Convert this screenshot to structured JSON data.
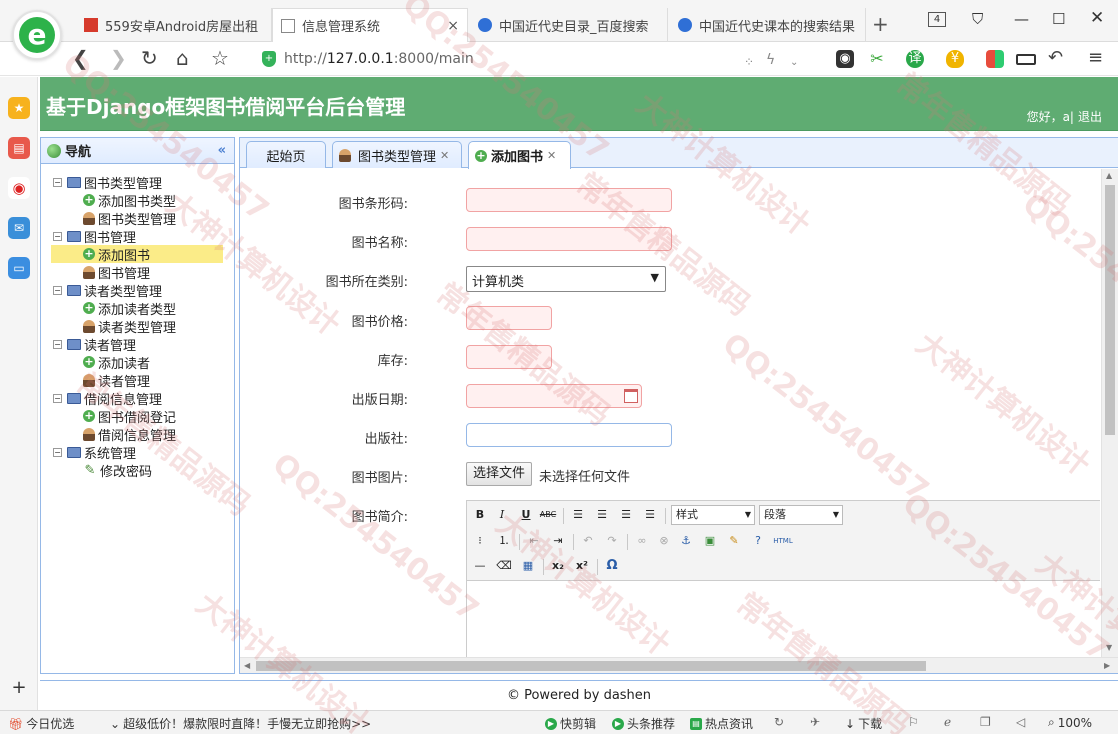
{
  "browser": {
    "tabs": [
      {
        "label": "559安卓Android房屋出租",
        "favicon_color": "#d63a2c"
      },
      {
        "label": "信息管理系统",
        "active": true
      },
      {
        "label": "中国近代史目录_百度搜索",
        "favicon_color": "#2f6fd6"
      },
      {
        "label": "中国近代史课本的搜索结果",
        "favicon_color": "#2f6fd6"
      }
    ],
    "tab_close": "×",
    "new_tab": "+",
    "tab_count": "4",
    "url_prefix": "http://",
    "url_host": "127.0.0.1",
    "url_rest": ":8000/main"
  },
  "app": {
    "title": "基于Django框架图书借阅平台后台管理",
    "greeting": "您好，a|",
    "logout": "退出",
    "accent_color": "#5fac72"
  },
  "nav": {
    "title": "导航",
    "collapse_icon": "«",
    "groups": [
      {
        "label": "图书类型管理",
        "children": [
          {
            "label": "添加图书类型",
            "icon": "add-icon"
          },
          {
            "label": "图书类型管理",
            "icon": "user-icon"
          }
        ]
      },
      {
        "label": "图书管理",
        "children": [
          {
            "label": "添加图书",
            "icon": "add-icon",
            "selected": true
          },
          {
            "label": "图书管理",
            "icon": "user-icon"
          }
        ]
      },
      {
        "label": "读者类型管理",
        "children": [
          {
            "label": "添加读者类型",
            "icon": "add-icon"
          },
          {
            "label": "读者类型管理",
            "icon": "user-icon"
          }
        ]
      },
      {
        "label": "读者管理",
        "children": [
          {
            "label": "添加读者",
            "icon": "add-icon"
          },
          {
            "label": "读者管理",
            "icon": "user-icon"
          }
        ]
      },
      {
        "label": "借阅信息管理",
        "children": [
          {
            "label": "图书借阅登记",
            "icon": "add-icon"
          },
          {
            "label": "借阅信息管理",
            "icon": "user-icon"
          }
        ]
      },
      {
        "label": "系统管理",
        "children": [
          {
            "label": "修改密码",
            "icon": "pencil-icon"
          }
        ]
      }
    ]
  },
  "main_tabs": [
    {
      "label": "起始页"
    },
    {
      "label": "图书类型管理",
      "closable": true
    },
    {
      "label": "添加图书",
      "closable": true,
      "active": true
    }
  ],
  "form": {
    "barcode_label": "图书条形码:",
    "name_label": "图书名称:",
    "category_label": "图书所在类别:",
    "category_value": "计算机类",
    "price_label": "图书价格:",
    "stock_label": "库存:",
    "date_label": "出版日期:",
    "publisher_label": "出版社:",
    "image_label": "图书图片:",
    "file_button": "选择文件",
    "file_status": "未选择任何文件",
    "intro_label": "图书简介:",
    "editor": {
      "style_dropdown": "样式",
      "paragraph_dropdown": "段落",
      "html_label": "HTML"
    }
  },
  "footer": "© Powered by dashen",
  "statusbar": {
    "left_item": "今日优选",
    "promo": "超级低价！爆款限时直降！手慢无立即抢购>>",
    "items": [
      "快剪辑",
      "头条推荐",
      "热点资讯",
      "下载"
    ],
    "zoom": "100%"
  },
  "watermark": {
    "lines": [
      "QQ:254540457",
      "大神计算机设计",
      "常年售精品源码"
    ]
  }
}
